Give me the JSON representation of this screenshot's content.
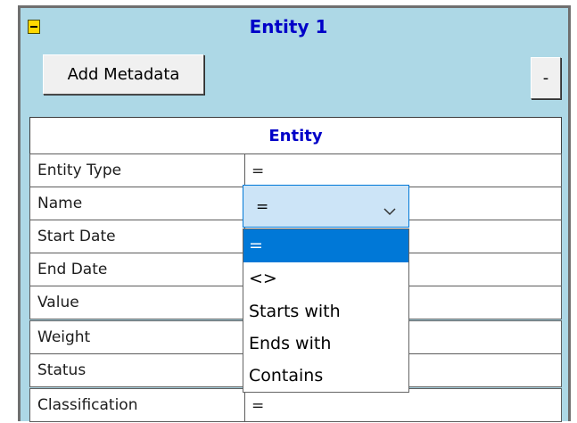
{
  "panel": {
    "title": "Entity 1",
    "add_metadata_label": "Add Metadata",
    "minus_label": "-"
  },
  "table": {
    "header": "Entity",
    "rows": [
      {
        "label": "Entity Type",
        "value": "="
      },
      {
        "label": "Name",
        "value": ""
      },
      {
        "label": "Start Date",
        "value": ""
      },
      {
        "label": "End Date",
        "value": ""
      },
      {
        "label": "Value",
        "value": ""
      },
      {
        "label": "Weight",
        "value": ""
      },
      {
        "label": "Status",
        "value": ""
      },
      {
        "label": "Classification",
        "value": "="
      }
    ]
  },
  "name_operator": {
    "selected": "=",
    "options": [
      "=",
      "<>",
      "Starts with",
      "Ends with",
      "Contains"
    ],
    "highlighted_index": 0
  },
  "colors": {
    "panel_bg": "#add8e6",
    "title": "#0000c8",
    "selection": "#0078d7"
  },
  "icons": [
    "collapse-icon",
    "chevron-down-icon"
  ]
}
